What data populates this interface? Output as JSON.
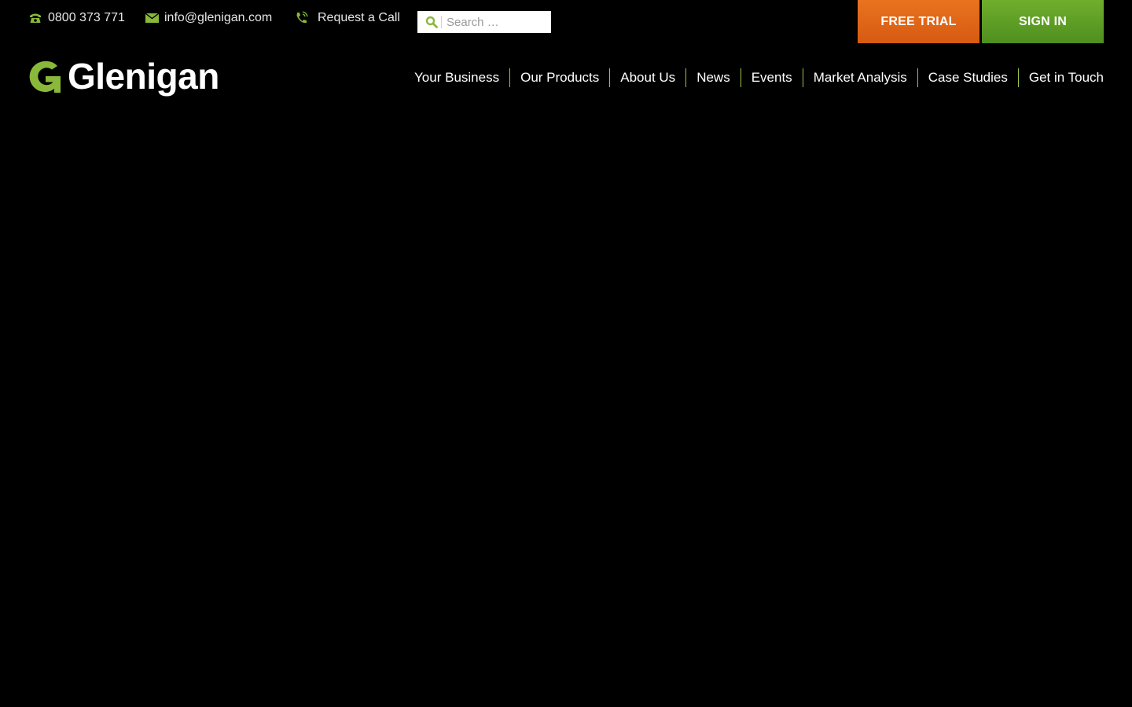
{
  "topbar": {
    "phone": {
      "icon": "phone-icon",
      "text": "0800 373 771"
    },
    "email": {
      "icon": "envelope-icon",
      "text": "info@glenigan.com"
    },
    "call": {
      "icon": "phone-ringing-icon",
      "text": "Request a Call"
    },
    "search": {
      "icon": "search-icon",
      "placeholder": "Search …",
      "value": ""
    },
    "free_trial_label": "FREE TRIAL",
    "sign_in_label": "SIGN IN"
  },
  "brand": {
    "name": "Glenigan",
    "logo_icon": "glenigan-g-logo"
  },
  "nav": {
    "items": [
      {
        "label": "Your Business"
      },
      {
        "label": "Our Products"
      },
      {
        "label": "About Us"
      },
      {
        "label": "News"
      },
      {
        "label": "Events"
      },
      {
        "label": "Market Analysis"
      },
      {
        "label": "Case Studies"
      },
      {
        "label": "Get in Touch"
      }
    ]
  },
  "colors": {
    "background": "#000000",
    "accent_green": "#8ab83a",
    "trial_orange": "#e26a18",
    "signin_green": "#5e9f25"
  }
}
